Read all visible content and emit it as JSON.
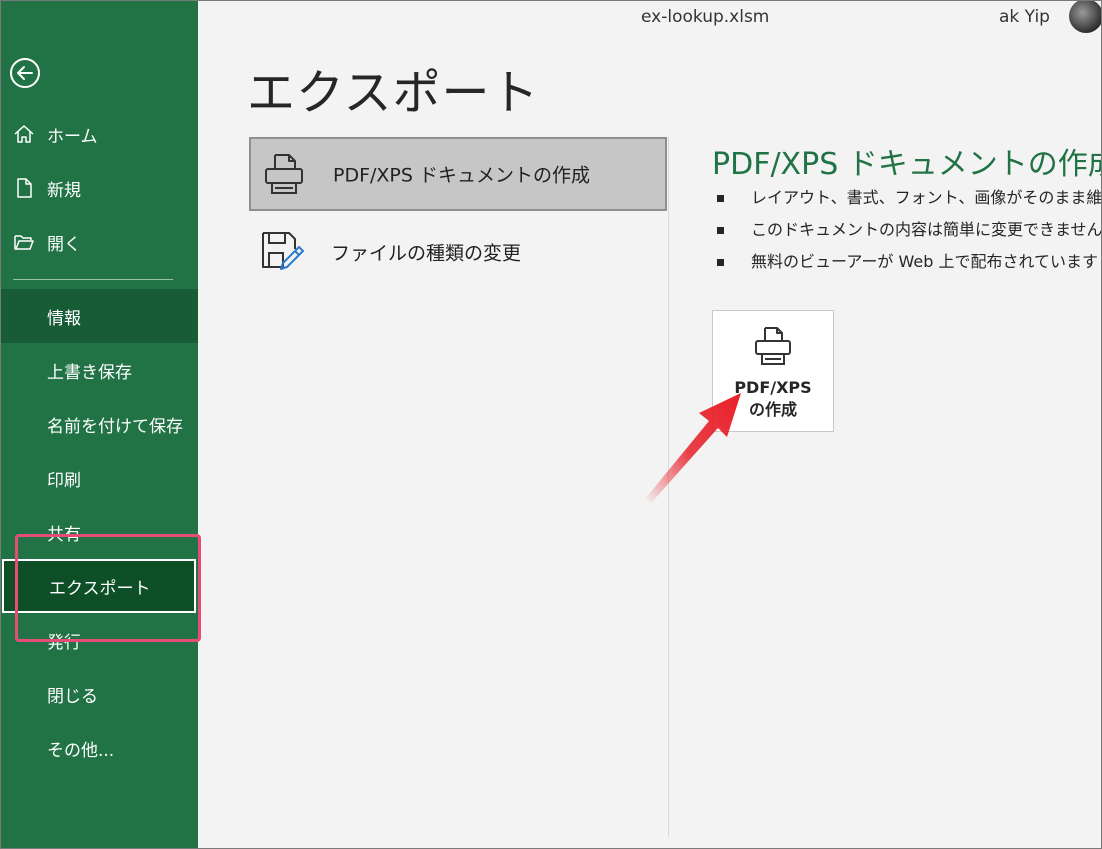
{
  "window": {
    "file_name": "ex-lookup.xlsm",
    "user_name": "ak Yip"
  },
  "sidebar": {
    "top_items": [
      {
        "label": "ホーム",
        "icon": "home-icon"
      },
      {
        "label": "新規",
        "icon": "new-document-icon"
      },
      {
        "label": "開く",
        "icon": "open-folder-icon"
      }
    ],
    "items": [
      {
        "label": "情報"
      },
      {
        "label": "上書き保存"
      },
      {
        "label": "名前を付けて保存"
      },
      {
        "label": "印刷"
      },
      {
        "label": "共有"
      },
      {
        "label": "エクスポート"
      },
      {
        "label": "発行"
      },
      {
        "label": "閉じる"
      },
      {
        "label": "その他..."
      }
    ],
    "selected": "エクスポート",
    "colors": {
      "background": "#217346",
      "info_background": "#185c37",
      "selected_background": "#0e4f27",
      "highlight_border": "#e84b77"
    }
  },
  "main": {
    "title": "エクスポート",
    "options": [
      {
        "label": "PDF/XPS ドキュメントの作成",
        "icon": "printer-document-icon",
        "selected": true
      },
      {
        "label": "ファイルの種類の変更",
        "icon": "file-type-change-icon",
        "selected": false
      }
    ]
  },
  "detail": {
    "title": "PDF/XPS ドキュメントの作成",
    "title_color": "#217346",
    "bullets": [
      "レイアウト、書式、フォント、画像がそのまま維持され",
      "このドキュメントの内容は簡単に変更できません",
      "無料のビューアーが Web 上で配布されています"
    ],
    "button": {
      "line1": "PDF/XPS",
      "line2": "の作成",
      "icon": "printer-icon"
    },
    "annotation_arrow_color": "#e8202a"
  }
}
